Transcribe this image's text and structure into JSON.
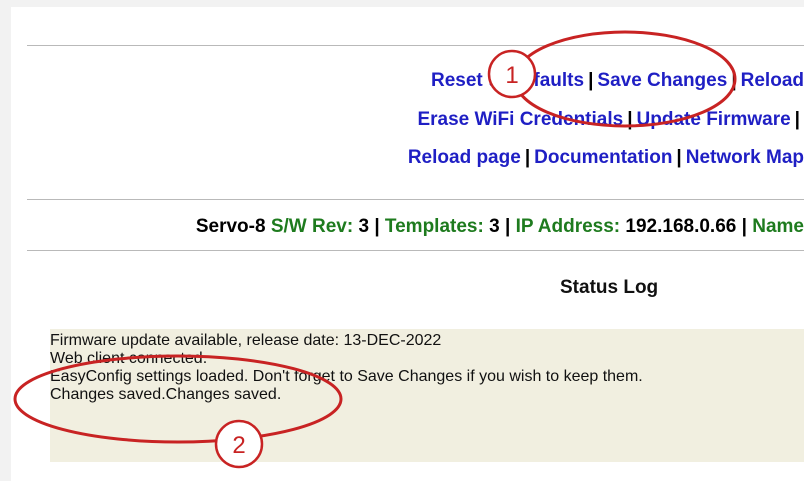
{
  "nav": {
    "row1": {
      "reset": "Reset to defaults",
      "save": "Save Changes",
      "reload": "Reload"
    },
    "row2": {
      "erase_wifi": "Erase WiFi Credentials",
      "update_firmware": "Update Firmware"
    },
    "row3": {
      "reload_page": "Reload page",
      "documentation": "Documentation",
      "network": "Network Map"
    },
    "separator": "|"
  },
  "device_info": {
    "device_name": "Servo-8",
    "sw_rev_label": "S/W Rev:",
    "sw_rev_value": "3",
    "templates_label": "Templates:",
    "templates_value": "3",
    "ip_label": "IP Address:",
    "ip_value": "192.168.0.66",
    "name_label": "Name"
  },
  "status_log": {
    "title": "Status Log",
    "lines": [
      "Firmware update available, release date: 13-DEC-2022",
      "Web client connected.",
      "EasyConfig settings loaded. Don't forget to Save Changes if you wish to keep them.",
      "Changes saved.Changes saved."
    ]
  },
  "callouts": {
    "one": "1",
    "two": "2",
    "color": "#c82323"
  }
}
